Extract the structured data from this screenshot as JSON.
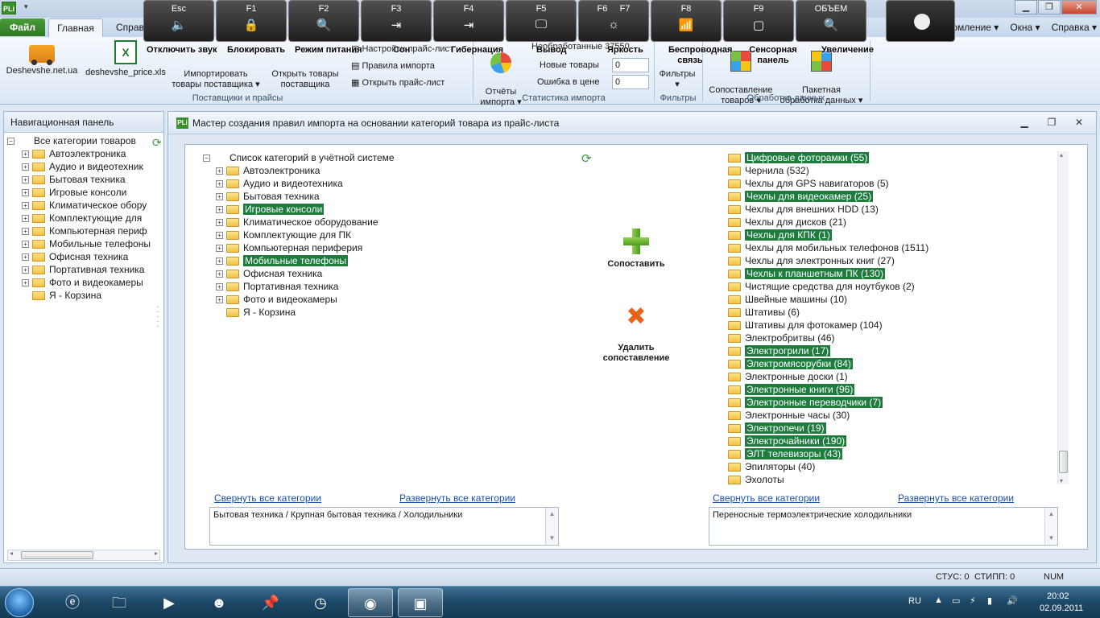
{
  "window": {
    "app_logo": "PLi",
    "qa_arrow": "▾"
  },
  "tabs": {
    "file": "Файл",
    "main": "Главная",
    "ref": "Справо"
  },
  "top_menus": [
    "омление",
    "Окна",
    "Справка"
  ],
  "fkeys": [
    {
      "key": "Esc",
      "icon": "🔈",
      "caption": "Отключить звук"
    },
    {
      "key": "F1",
      "icon": "🔒",
      "caption": "Блокировать"
    },
    {
      "key": "F2",
      "icon": "🔍",
      "caption": "Режим питания"
    },
    {
      "key": "F3",
      "icon": "⇥",
      "caption": "Сон"
    },
    {
      "key": "F4",
      "icon": "⇥",
      "caption": "Гибернация"
    },
    {
      "key": "F5",
      "icon": "🖵",
      "caption": "Вывод"
    },
    {
      "key": "F6",
      "icon": "☼",
      "caption": "Яркость"
    },
    {
      "key": "F7",
      "icon": "",
      "caption": ""
    },
    {
      "key": "F8",
      "icon": "📶",
      "caption": "Беспроводная связь"
    },
    {
      "key": "F9",
      "icon": "▢",
      "caption": "Сенсорная панель"
    },
    {
      "key": "ОБЪЕМ",
      "icon": "🔍",
      "caption": "Увеличение"
    }
  ],
  "ribbon": {
    "btn_deshevshe": "Deshevshe.net.ua",
    "btn_price_xls": "deshevshe_price.xls",
    "btn_import_supplier": "Импортировать\nтовары поставщика",
    "btn_open_supplier": "Открыть товары\nпоставщика",
    "menu_settings_price": "Настройки прайс-лист",
    "menu_import_rules": "Правила импорта",
    "menu_open_price": "Открыть прайс-лист",
    "btn_reports": "Отчёты\nимпорта",
    "stat_unprocessed_label": "Необработанные",
    "stat_unprocessed_value": "37550",
    "stat_new_label": "Новые товары",
    "stat_new_value": "0",
    "stat_error_label": "Ошибка в цене",
    "stat_error_value": "0",
    "btn_filters": "Фильтры",
    "btn_compare": "Сопоставление\nтоваров",
    "btn_batch": "Пакетная\nобработка данных",
    "group_suppliers": "Поставщики и прайсы",
    "group_stats": "Статистика импорта",
    "group_filters": "Фильтры",
    "group_processing": "Обработка данных"
  },
  "nav": {
    "header": "Навигационная панель",
    "root": "Все категории товаров",
    "items": [
      "Автоэлектроника",
      "Аудио и видеотехник",
      "Бытовая техника",
      "Игровые консоли",
      "Климатическое обору",
      "Комплектующие для",
      "Компьютерная периф",
      "Мобильные телефоны",
      "Офисная техника",
      "Портативная техника",
      "Фото и видеокамеры",
      "Я - Корзина"
    ]
  },
  "wizard": {
    "title": "Мастер создания правил импорта на основании категорий товара из прайс-листа",
    "icon_text": "PLi",
    "left_root": "Список категорий в учётной системе",
    "left_items": [
      {
        "label": "Автоэлектроника",
        "selected": false,
        "expandable": true
      },
      {
        "label": "Аудио и видеотехника",
        "selected": false,
        "expandable": true
      },
      {
        "label": "Бытовая техника",
        "selected": false,
        "expandable": true
      },
      {
        "label": "Игровые консоли",
        "selected": true,
        "expandable": true
      },
      {
        "label": "Климатическое оборудование",
        "selected": false,
        "expandable": true
      },
      {
        "label": "Комплектующие для ПК",
        "selected": false,
        "expandable": true
      },
      {
        "label": "Компьютерная периферия",
        "selected": false,
        "expandable": true
      },
      {
        "label": "Мобильные телефоны",
        "selected": true,
        "expandable": true
      },
      {
        "label": "Офисная техника",
        "selected": false,
        "expandable": true
      },
      {
        "label": "Портативная техника",
        "selected": false,
        "expandable": true
      },
      {
        "label": "Фото и видеокамеры",
        "selected": false,
        "expandable": true
      },
      {
        "label": "Я - Корзина",
        "selected": false,
        "expandable": false
      }
    ],
    "right_items": [
      {
        "label": "Цифровые фоторамки (55)",
        "selected": true
      },
      {
        "label": "Чернила (532)",
        "selected": false
      },
      {
        "label": "Чехлы для GPS навигаторов (5)",
        "selected": false
      },
      {
        "label": "Чехлы для видеокамер (25)",
        "selected": true
      },
      {
        "label": "Чехлы для внешних HDD (13)",
        "selected": false
      },
      {
        "label": "Чехлы для дисков (21)",
        "selected": false
      },
      {
        "label": "Чехлы для КПК (1)",
        "selected": true
      },
      {
        "label": "Чехлы для мобильных телефонов (1511)",
        "selected": false
      },
      {
        "label": "Чехлы для электронных книг (27)",
        "selected": false
      },
      {
        "label": "Чехлы к планшетным ПК (130)",
        "selected": true
      },
      {
        "label": "Чистящие средства для ноутбуков (2)",
        "selected": false
      },
      {
        "label": "Швейные машины (10)",
        "selected": false
      },
      {
        "label": "Штативы (6)",
        "selected": false
      },
      {
        "label": "Штативы для фотокамер (104)",
        "selected": false
      },
      {
        "label": "Электробритвы (46)",
        "selected": false
      },
      {
        "label": "Электрогрили (17)",
        "selected": true
      },
      {
        "label": "Электромясорубки (84)",
        "selected": true
      },
      {
        "label": "Электронные доски (1)",
        "selected": false
      },
      {
        "label": "Электронные книги (96)",
        "selected": true
      },
      {
        "label": "Электронные переводчики (7)",
        "selected": true
      },
      {
        "label": "Электронные часы (30)",
        "selected": false
      },
      {
        "label": "Электропечи (19)",
        "selected": true
      },
      {
        "label": "Электрочайники (190)",
        "selected": true
      },
      {
        "label": "ЭЛТ телевизоры (43)",
        "selected": true
      },
      {
        "label": "Эпиляторы (40)",
        "selected": false
      },
      {
        "label": "Эхолоты",
        "selected": false
      }
    ],
    "btn_match": "Сопоставить",
    "btn_delete": "Удалить\nсопоставление",
    "collapse_all": "Свернуть все категории",
    "expand_all": "Развернуть все категории",
    "left_path": "Бытовая техника / Крупная бытовая техника / Холодильники",
    "right_path": "Переносные термоэлектрические холодильники"
  },
  "status": {
    "stus": "СТУС: 0",
    "stipp": "СТИПП: 0",
    "num": "NUM"
  },
  "tray": {
    "lang": "RU",
    "time": "20:02",
    "date": "02.09.2011"
  },
  "colors": {
    "selection": "#1e7d3e",
    "accent_green": "#2f7a22",
    "link": "#1a4fb5"
  }
}
